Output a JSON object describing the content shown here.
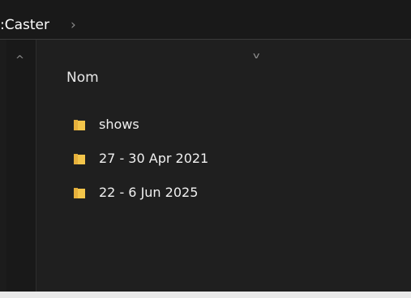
{
  "colors": {
    "window_bg": "#1c1c1c",
    "pane_bg": "#191919",
    "content_bg": "#1f1f1f",
    "text": "#f0f0f0",
    "folder_yellow": "#f3c54a"
  },
  "address_bar": {
    "crumb_text": ":Caster",
    "separator": "›"
  },
  "nav_pane": {
    "scroll_up_glyph": "^"
  },
  "file_list": {
    "sort_glyph": "v",
    "column_name_header": "Nom",
    "items": [
      {
        "name": "shows",
        "icon": "folder-icon"
      },
      {
        "name": "27 - 30 Apr 2021",
        "icon": "folder-icon"
      },
      {
        "name": "22 - 6 Jun 2025",
        "icon": "folder-icon"
      }
    ]
  }
}
